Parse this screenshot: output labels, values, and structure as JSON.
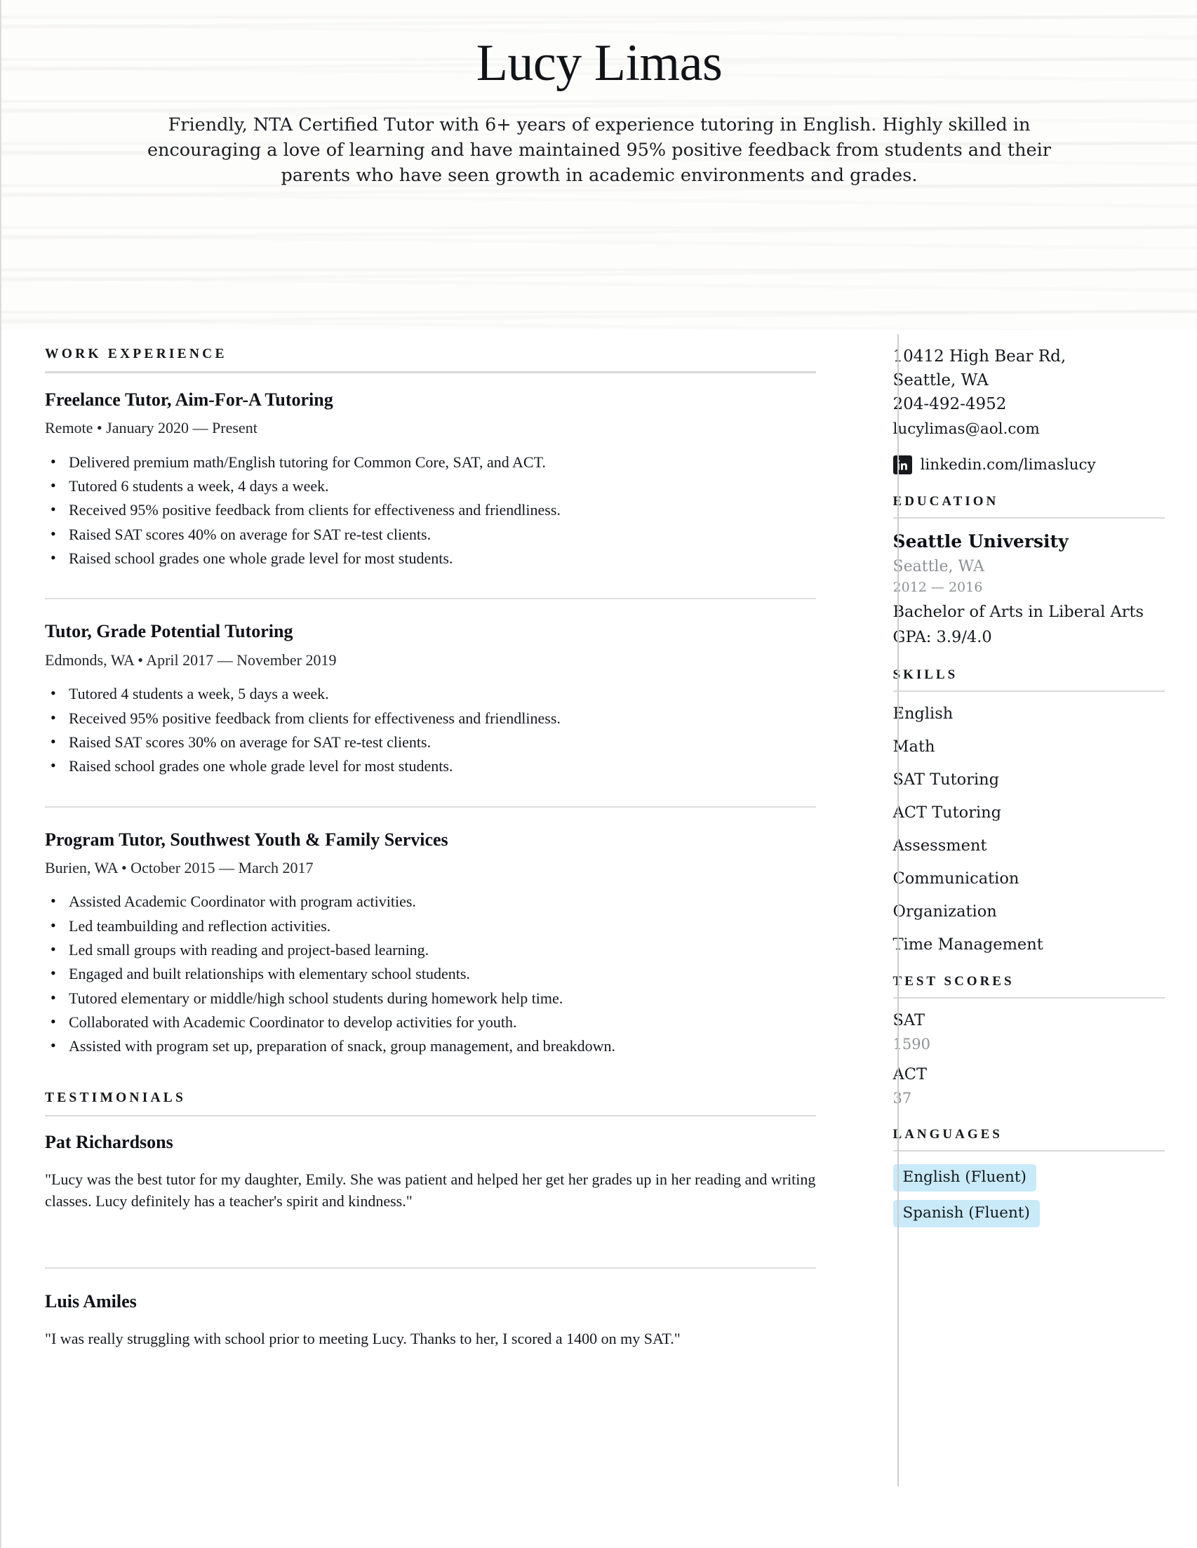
{
  "header": {
    "name": "Lucy Limas",
    "summary": "Friendly, NTA Certified Tutor with 6+ years of experience tutoring in English. Highly skilled in encouraging a love of learning and have maintained 95% positive feedback from students and their parents who have seen growth in academic environments and grades."
  },
  "main": {
    "work_heading": "WORK EXPERIENCE",
    "jobs": [
      {
        "title": "Freelance Tutor, Aim-For-A Tutoring",
        "meta": "Remote • January 2020 — Present",
        "bullets": [
          "Delivered premium math/English tutoring for Common Core, SAT, and ACT.",
          "Tutored 6 students a week, 4 days a week.",
          "Received 95% positive feedback from clients for effectiveness and friendliness.",
          "Raised SAT scores 40% on average for SAT re-test clients.",
          "Raised school grades one whole grade level for most students."
        ]
      },
      {
        "title": "Tutor, Grade Potential Tutoring",
        "meta": "Edmonds, WA • April 2017 — November 2019",
        "bullets": [
          "Tutored 4 students a week, 5 days a week.",
          "Received 95% positive feedback from clients for effectiveness and friendliness.",
          "Raised SAT scores 30% on average for SAT re-test clients.",
          "Raised school grades one whole grade level for most students."
        ]
      },
      {
        "title": "Program Tutor, Southwest Youth & Family Services",
        "meta": "Burien, WA • October 2015 — March 2017",
        "bullets": [
          "Assisted Academic Coordinator with program activities.",
          "Led teambuilding and reflection activities.",
          "Led small groups with reading and project-based learning.",
          "Engaged and built relationships with elementary school students.",
          "Tutored elementary or middle/high school students during homework help time.",
          "Collaborated with Academic Coordinator to develop activities for youth.",
          "Assisted with program set up, preparation of snack, group management, and breakdown."
        ]
      }
    ],
    "testimonials_heading": "TESTIMONIALS",
    "testimonials": [
      {
        "name": "Pat Richardsons",
        "quote": "\"Lucy was the best tutor for my daughter, Emily. She was patient and helped her get her grades up in her reading and writing classes. Lucy definitely has a teacher's spirit and kindness.\""
      },
      {
        "name": "Luis Amiles",
        "quote": "\"I was really struggling with school prior to meeting Lucy. Thanks to her, I scored a 1400 on my SAT.\""
      }
    ]
  },
  "sidebar": {
    "contact": {
      "address_line1": "10412 High Bear Rd,",
      "address_line2": "Seattle, WA",
      "phone": "204-492-4952",
      "email": "lucylimas@aol.com",
      "linkedin": "linkedin.com/limaslucy",
      "linkedin_icon": "linkedin-icon"
    },
    "education_heading": "EDUCATION",
    "education": {
      "school": "Seattle University",
      "location": "Seattle, WA",
      "dates": "2012 — 2016",
      "degree": "Bachelor of Arts in Liberal Arts",
      "gpa": "GPA: 3.9/4.0"
    },
    "skills_heading": "SKILLS",
    "skills": [
      "English",
      "Math",
      "SAT Tutoring",
      "ACT Tutoring",
      "Assessment",
      "Communication",
      "Organization",
      "Time Management"
    ],
    "test_scores_heading": "TEST SCORES",
    "test_scores": [
      {
        "label": "SAT",
        "value": "1590"
      },
      {
        "label": "ACT",
        "value": "37"
      }
    ],
    "languages_heading": "LANGUAGES",
    "languages": [
      "English (Fluent)",
      "Spanish (Fluent)"
    ]
  },
  "colors": {
    "language_badge_bg": "#c9eaf8",
    "rule": "#d9d9d9",
    "muted_text": "#8e9095",
    "text": "#15181d"
  }
}
